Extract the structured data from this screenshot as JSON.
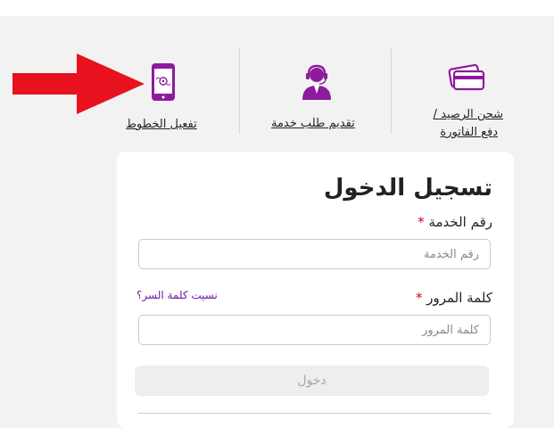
{
  "quick_links": [
    {
      "label": "تفعيل الخطوط",
      "icon": "mobile-phone-icon"
    },
    {
      "label": "تقديم طلب خدمة",
      "icon": "support-agent-icon"
    },
    {
      "label_line1": "شحن الرصيد /",
      "label_line2": "دفع الفاتورة",
      "icon": "credit-cards-icon"
    }
  ],
  "login": {
    "title": "تسجيل الدخول",
    "service_number_label": "رقم الخدمة",
    "service_number_placeholder": "رقم الخدمة",
    "password_label": "كلمة المرور",
    "password_placeholder": "كلمة المرور",
    "required_mark": "*",
    "forgot_password": "نسيت كلمة السر؟",
    "submit": "دخول"
  },
  "colors": {
    "brand_purple": "#8e1a9e",
    "arrow_red": "#e8111e",
    "link_purple": "#6b1aa5"
  }
}
